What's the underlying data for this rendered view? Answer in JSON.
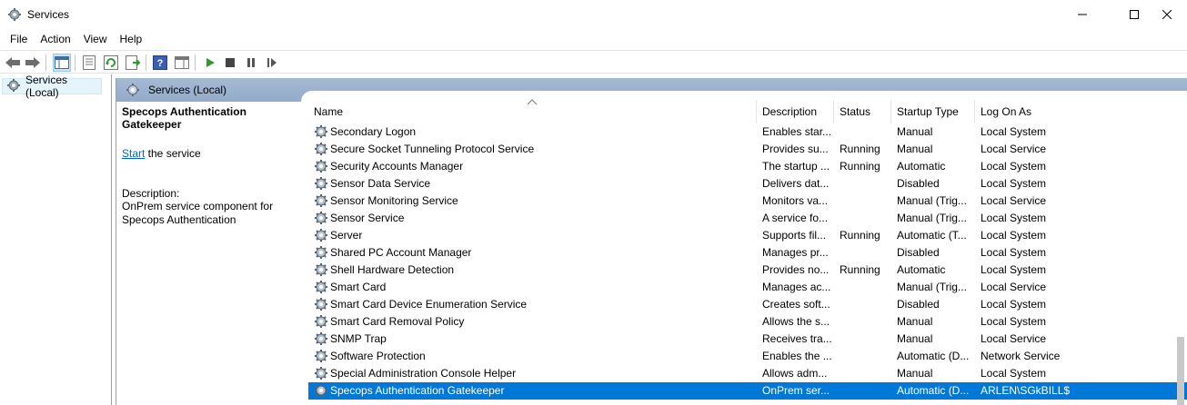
{
  "window": {
    "title": "Services"
  },
  "menu": [
    "File",
    "Action",
    "View",
    "Help"
  ],
  "tree": {
    "root_label": "Services (Local)"
  },
  "pane": {
    "header_title": "Services (Local)"
  },
  "extended": {
    "service_name": "Specops Authentication Gatekeeper",
    "start_link": "Start",
    "start_suffix": " the service",
    "description_label": "Description:",
    "description_text": "OnPrem service component for Specops Authentication"
  },
  "columns": {
    "name": "Name",
    "description": "Description",
    "status": "Status",
    "startup_type": "Startup Type",
    "log_on_as": "Log On As"
  },
  "rows": [
    {
      "name": "Secondary Logon",
      "description": "Enables star...",
      "status": "",
      "startup": "Manual",
      "logon": "Local System"
    },
    {
      "name": "Secure Socket Tunneling Protocol Service",
      "description": "Provides su...",
      "status": "Running",
      "startup": "Manual",
      "logon": "Local Service"
    },
    {
      "name": "Security Accounts Manager",
      "description": "The startup ...",
      "status": "Running",
      "startup": "Automatic",
      "logon": "Local System"
    },
    {
      "name": "Sensor Data Service",
      "description": "Delivers dat...",
      "status": "",
      "startup": "Disabled",
      "logon": "Local System"
    },
    {
      "name": "Sensor Monitoring Service",
      "description": "Monitors va...",
      "status": "",
      "startup": "Manual (Trig...",
      "logon": "Local Service"
    },
    {
      "name": "Sensor Service",
      "description": "A service fo...",
      "status": "",
      "startup": "Manual (Trig...",
      "logon": "Local System"
    },
    {
      "name": "Server",
      "description": "Supports fil...",
      "status": "Running",
      "startup": "Automatic (T...",
      "logon": "Local System"
    },
    {
      "name": "Shared PC Account Manager",
      "description": "Manages pr...",
      "status": "",
      "startup": "Disabled",
      "logon": "Local System"
    },
    {
      "name": "Shell Hardware Detection",
      "description": "Provides no...",
      "status": "Running",
      "startup": "Automatic",
      "logon": "Local System"
    },
    {
      "name": "Smart Card",
      "description": "Manages ac...",
      "status": "",
      "startup": "Manual (Trig...",
      "logon": "Local Service"
    },
    {
      "name": "Smart Card Device Enumeration Service",
      "description": "Creates soft...",
      "status": "",
      "startup": "Disabled",
      "logon": "Local System"
    },
    {
      "name": "Smart Card Removal Policy",
      "description": "Allows the s...",
      "status": "",
      "startup": "Manual",
      "logon": "Local System"
    },
    {
      "name": "SNMP Trap",
      "description": "Receives tra...",
      "status": "",
      "startup": "Manual",
      "logon": "Local Service"
    },
    {
      "name": "Software Protection",
      "description": "Enables the ...",
      "status": "",
      "startup": "Automatic (D...",
      "logon": "Network Service"
    },
    {
      "name": "Special Administration Console Helper",
      "description": "Allows adm...",
      "status": "",
      "startup": "Manual",
      "logon": "Local System"
    },
    {
      "name": "Specops Authentication Gatekeeper",
      "description": "OnPrem ser...",
      "status": "",
      "startup": "Automatic (D...",
      "logon": "ARLEN\\SGkBILL$"
    }
  ],
  "selected_index": 15,
  "colors": {
    "selection": "#0078d7",
    "header": "#a4bad4",
    "link": "#0066cc"
  }
}
